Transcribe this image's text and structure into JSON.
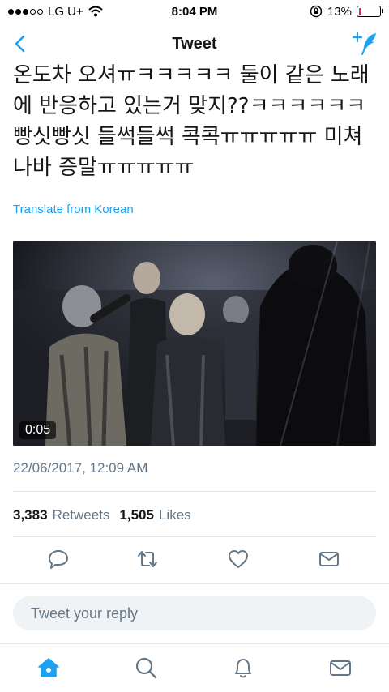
{
  "status_bar": {
    "carrier": "LG U+",
    "time": "8:04 PM",
    "battery": "13%",
    "battery_level": 0.13,
    "signal_bars_filled": 3,
    "signal_bars_total": 5
  },
  "nav": {
    "title": "Tweet",
    "back_icon": "chevron-left-icon",
    "compose_icon": "compose-tweet-icon"
  },
  "tweet": {
    "text": "온도차 오셔ㅠㅋㅋㅋㅋㅋ 둘이 같은 노래\n에 반응하고 있는거 맞지??ㅋㅋㅋㅋㅋㅋ\n빵싯빵싯 들썩들썩 콕콕ㅠㅠㅠㅠㅠ 미쳐\n나바 증말ㅠㅠㅠㅠㅠ",
    "translate_label": "Translate from Korean",
    "video_duration": "0:05",
    "timestamp": "22/06/2017, 12:09 AM",
    "retweets_count": "3,383",
    "retweets_label": "Retweets",
    "likes_count": "1,505",
    "likes_label": "Likes"
  },
  "actions": [
    "reply-icon",
    "retweet-icon",
    "like-heart-icon",
    "direct-message-icon"
  ],
  "reply": {
    "placeholder": "Tweet your reply"
  },
  "tabbar": [
    "home-icon",
    "search-icon",
    "notifications-bell-icon",
    "messages-icon"
  ],
  "colors": {
    "accent": "#1da1f2",
    "muted": "#657786",
    "text": "#14171a",
    "battery_low": "#e0245e"
  }
}
